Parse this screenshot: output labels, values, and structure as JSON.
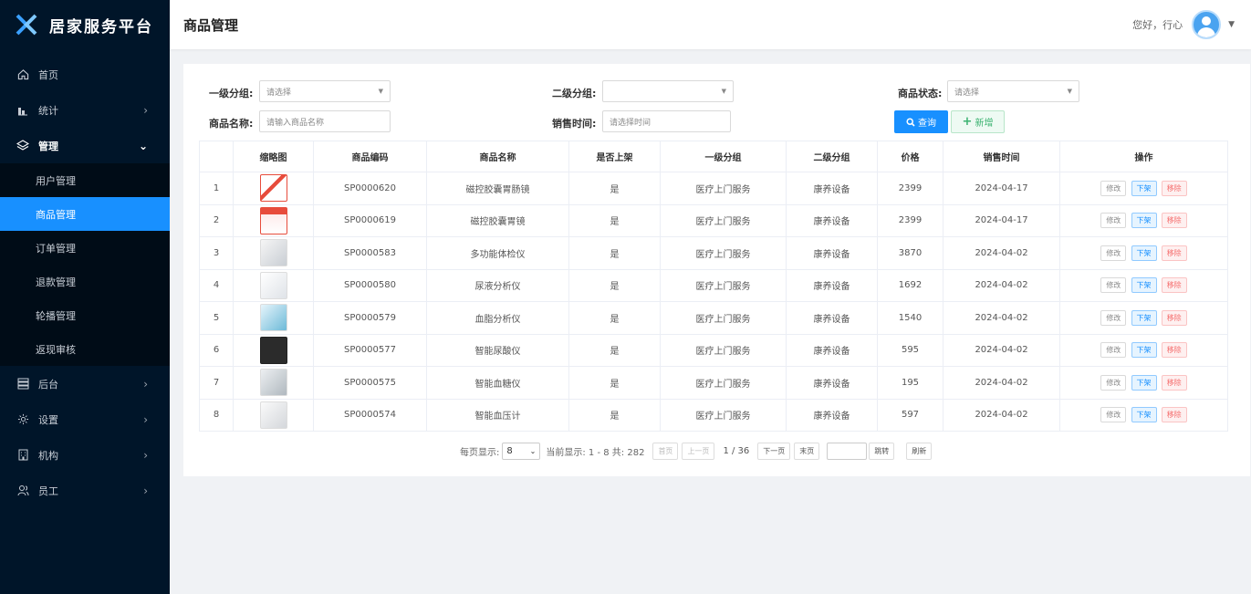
{
  "brand": {
    "title": "居家服务平台"
  },
  "nav": {
    "items": [
      {
        "label": "首页",
        "icon": "home-icon"
      },
      {
        "label": "统计",
        "icon": "chart-icon"
      },
      {
        "label": "管理",
        "icon": "layers-icon"
      },
      {
        "label": "后台",
        "icon": "server-icon"
      },
      {
        "label": "设置",
        "icon": "gear-icon"
      },
      {
        "label": "机构",
        "icon": "building-icon"
      },
      {
        "label": "员工",
        "icon": "users-icon"
      }
    ],
    "sub_items": [
      "用户管理",
      "商品管理",
      "订单管理",
      "退款管理",
      "轮播管理",
      "返现审核"
    ],
    "active_sub": "商品管理"
  },
  "header": {
    "title": "商品管理",
    "greeting": "您好，行心"
  },
  "filters": {
    "cat1_label": "一级分组:",
    "cat1_value": "请选择",
    "cat2_label": "二级分组:",
    "cat2_value": "",
    "status_label": "商品状态:",
    "status_value": "请选择",
    "name_label": "商品名称:",
    "name_placeholder": "请输入商品名称",
    "time_label": "销售时间:",
    "time_placeholder": "请选择时间",
    "query_label": "查询",
    "add_label": "新增"
  },
  "table": {
    "headers": [
      "",
      "缩略图",
      "商品编码",
      "商品名称",
      "是否上架",
      "一级分组",
      "二级分组",
      "价格",
      "销售时间",
      "操作"
    ],
    "actions": {
      "edit": "修改",
      "down": "下架",
      "remove": "移除"
    },
    "rows": [
      {
        "idx": "1",
        "thumb": "t-red",
        "code": "SP0000620",
        "name": "磁控胶囊胃肠镜",
        "listed": "是",
        "cat1": "医疗上门服务",
        "cat2": "康养设备",
        "price": "2399",
        "date": "2024-04-17"
      },
      {
        "idx": "2",
        "thumb": "t-red2",
        "code": "SP0000619",
        "name": "磁控胶囊胃镜",
        "listed": "是",
        "cat1": "医疗上门服务",
        "cat2": "康养设备",
        "price": "2399",
        "date": "2024-04-17"
      },
      {
        "idx": "3",
        "thumb": "t-grey",
        "code": "SP0000583",
        "name": "多功能体检仪",
        "listed": "是",
        "cat1": "医疗上门服务",
        "cat2": "康养设备",
        "price": "3870",
        "date": "2024-04-02"
      },
      {
        "idx": "4",
        "thumb": "t-white",
        "code": "SP0000580",
        "name": "尿液分析仪",
        "listed": "是",
        "cat1": "医疗上门服务",
        "cat2": "康养设备",
        "price": "1692",
        "date": "2024-04-02"
      },
      {
        "idx": "5",
        "thumb": "t-blue",
        "code": "SP0000579",
        "name": "血脂分析仪",
        "listed": "是",
        "cat1": "医疗上门服务",
        "cat2": "康养设备",
        "price": "1540",
        "date": "2024-04-02"
      },
      {
        "idx": "6",
        "thumb": "t-black",
        "code": "SP0000577",
        "name": "智能尿酸仪",
        "listed": "是",
        "cat1": "医疗上门服务",
        "cat2": "康养设备",
        "price": "595",
        "date": "2024-04-02"
      },
      {
        "idx": "7",
        "thumb": "t-silver",
        "code": "SP0000575",
        "name": "智能血糖仪",
        "listed": "是",
        "cat1": "医疗上门服务",
        "cat2": "康养设备",
        "price": "195",
        "date": "2024-04-02"
      },
      {
        "idx": "8",
        "thumb": "t-pale",
        "code": "SP0000574",
        "name": "智能血压计",
        "listed": "是",
        "cat1": "医疗上门服务",
        "cat2": "康养设备",
        "price": "597",
        "date": "2024-04-02"
      }
    ]
  },
  "pager": {
    "per_page_label": "每页显示:",
    "per_page_value": "8",
    "current_label": "当前显示: 1 - 8  共: 282",
    "first": "首页",
    "prev": "上一页",
    "page": "1 / 36",
    "next": "下一页",
    "last": "末页",
    "jump": "跳转",
    "refresh": "刷新"
  },
  "colors": {
    "sidebar": "#001529",
    "accent": "#1890ff",
    "add": "#3cb371",
    "danger": "#f56c6c"
  }
}
